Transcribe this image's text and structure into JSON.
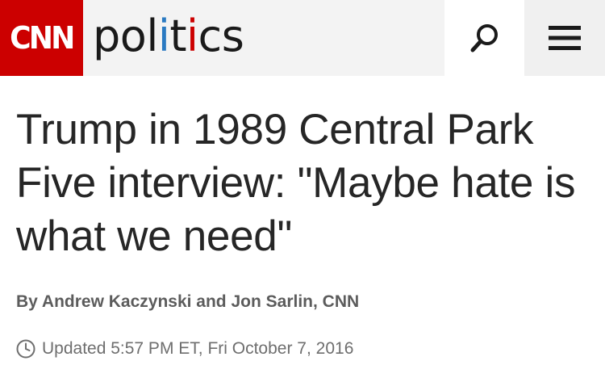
{
  "header": {
    "logo_text": "CNN",
    "section_parts": [
      "pol",
      "i",
      "t",
      "i",
      "cs"
    ],
    "search_icon": "search-icon",
    "menu_icon": "hamburger-menu-icon",
    "colors": {
      "brand_red": "#cc0000",
      "accent_blue": "#2a7ac2",
      "header_bg": "#f3f3f3"
    }
  },
  "article": {
    "headline": "Trump in 1989 Central Park Five interview: \"Maybe hate is what we need\"",
    "byline": "By Andrew Kaczynski and Jon Sarlin, CNN",
    "updated": "Updated 5:57 PM ET, Fri October 7, 2016",
    "clock_icon": "clock-icon"
  }
}
